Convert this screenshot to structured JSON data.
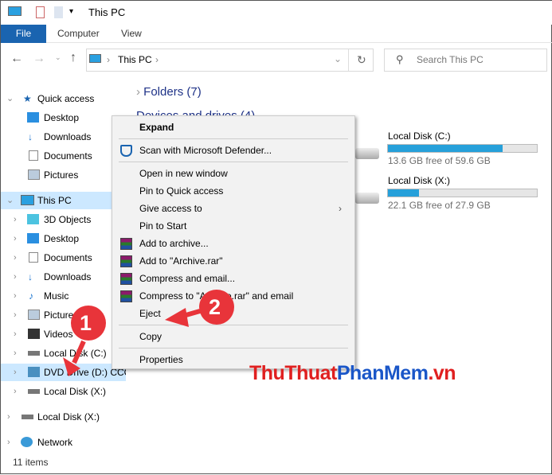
{
  "window": {
    "title": "This PC"
  },
  "ribbon": {
    "tabs": [
      "File",
      "Computer",
      "View"
    ]
  },
  "address": {
    "path": "This PC",
    "search_placeholder": "Search This PC"
  },
  "content": {
    "folders_header": "Folders (7)",
    "devices_header": "Devices and drives (4)",
    "drives": [
      {
        "name": "Local Disk (C:)",
        "free": "13.6 GB free of 59.6 GB",
        "used_fraction": 0.77
      },
      {
        "name": "Local Disk (X:)",
        "free": "22.1 GB free of 27.9 GB",
        "used_fraction": 0.21
      }
    ]
  },
  "nav": {
    "items": [
      "Quick access",
      "Desktop",
      "Downloads",
      "Documents",
      "Pictures",
      "This PC",
      "3D Objects",
      "Desktop",
      "Documents",
      "Downloads",
      "Music",
      "Pictures",
      "Videos",
      "Local Disk (C:)",
      "DVD Drive (D:) CCC",
      "Local Disk (X:)",
      "Local Disk (X:)",
      "Network"
    ]
  },
  "context_menu": {
    "items": [
      "Expand",
      "Scan with Microsoft Defender...",
      "Open in new window",
      "Pin to Quick access",
      "Give access to",
      "Pin to Start",
      "Add to archive...",
      "Add to \"Archive.rar\"",
      "Compress and email...",
      "Compress to \"Archive.rar\" and email",
      "Eject",
      "Copy",
      "Properties"
    ]
  },
  "annotations": [
    "1",
    "2"
  ],
  "watermark": {
    "a": "ThuThuat",
    "b": "PhanMem",
    "c": ".vn"
  },
  "status": {
    "count": "11 items"
  },
  "colors": {
    "accent": "#1a64b0",
    "selection": "#cce8ff",
    "progress": "#26a0da",
    "annotation": "#e8343a"
  }
}
